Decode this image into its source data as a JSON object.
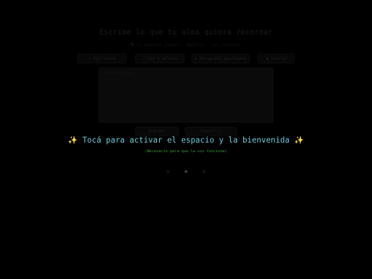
{
  "page": {
    "title": "Escribe lo que tu alma quiera recordar",
    "subtitle": "tu espacio seguro · memoria · voz interior"
  },
  "toolbar": {
    "items": [
      {
        "label": "✎ Escritura"
      },
      {
        "label": "♪ Voz y música"
      },
      {
        "label": "❖ Recuerdos guardados"
      },
      {
        "label": "◉ Diario"
      }
    ]
  },
  "editor": {
    "placeholder": "Querida alma..."
  },
  "actions": {
    "save_label": "Guardar",
    "clear_label": "Compartir"
  },
  "overlay": {
    "cta_spark_left": "✨",
    "cta_text": "Tocá para activar el espacio y la bienvenida",
    "cta_spark_right": "✨",
    "note": "(Necesario para que la voz funcione)"
  },
  "colors": {
    "background": "#000000",
    "cta": "#67c8d8",
    "spark": "#f2d54a",
    "note": "#2f9a2f"
  }
}
